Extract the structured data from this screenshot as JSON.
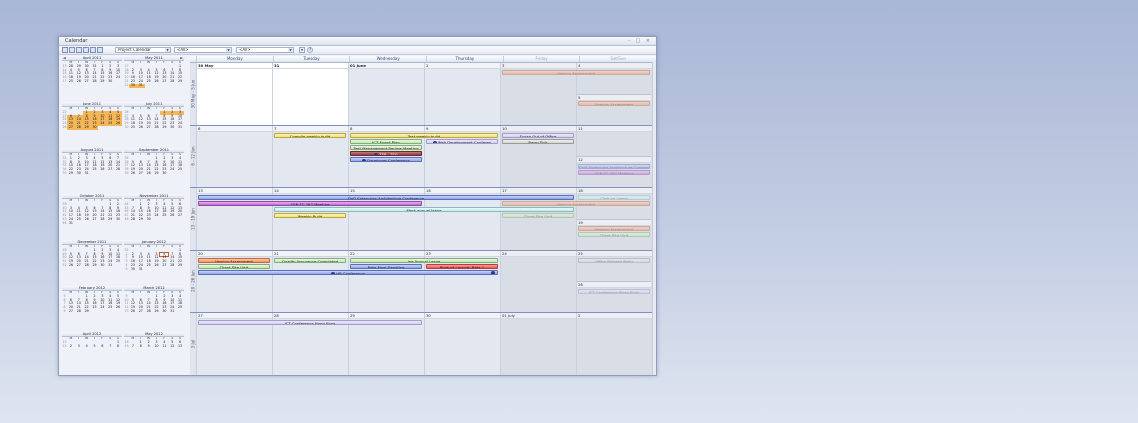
{
  "window": {
    "title": "Calendar",
    "controls": "- □ ×"
  },
  "toolbar": {
    "calendar_select": "Project Calendar",
    "filter1": "<All>",
    "filter2": "<All>"
  },
  "day_headers": [
    "Monday",
    "Tuesday",
    "Wednesday",
    "Thursday",
    "Friday",
    "Sat/Sun"
  ],
  "mini_months": [
    {
      "name": "April 2011",
      "rows": [
        "13 28 29 30 31 1 2 3",
        "14 4 5 6 7 8 9 10",
        "15 11 12 13 14 15 16 17",
        "16 18 19 20 21 22 23 24",
        "17 25 26 27 28 29 30"
      ]
    },
    {
      "name": "May 2011",
      "rows": [
        "17 . . . . . . 1",
        "18 2 3 4 5 6 7 8",
        "19 9 10 11 12 13 14 15",
        "20 16 17 18 19 20 21 22",
        "21 23 24 25 26 27 28 29",
        "22 30 31"
      ]
    },
    {
      "name": "June 2011",
      "rows": [
        "22 . . 1 2 3 4 5",
        "23 6 7 8 9 10 11 12",
        "24 13 14 15 16 17 18 19",
        "25 20 21 22 23 24 25 26",
        "26 27 28 29 30"
      ]
    },
    {
      "name": "July 2011",
      "rows": [
        "26 . . . . 1 2 3",
        "27 4 5 6 7 8 9 10",
        "28 11 12 13 14 15 16 17",
        "29 18 19 20 21 22 23 24",
        "30 25 26 27 28 29 30 31"
      ]
    },
    {
      "name": "August 2011",
      "rows": [
        "31 1 2 3 4 5 6 7",
        "32 8 9 10 11 12 13 14",
        "33 15 16 17 18 19 20 21",
        "34 22 23 24 25 26 27 28",
        "35 29 30 31"
      ]
    },
    {
      "name": "September 2011",
      "rows": [
        "35 . . . 1 2 3 4",
        "36 5 6 7 8 9 10 11",
        "37 12 13 14 15 16 17 18",
        "38 19 20 21 22 23 24 25",
        "39 26 27 28 29 30"
      ]
    },
    {
      "name": "October 2011",
      "rows": [
        "39 . . . . . 1 2",
        "40 3 4 5 6 7 8 9",
        "41 10 11 12 13 14 15 16",
        "42 17 18 19 20 21 22 23",
        "43 24 25 26 27 28 29 30",
        "44 31"
      ]
    },
    {
      "name": "November 2011",
      "rows": [
        "44 . 1 2 3 4 5 6",
        "45 7 8 9 10 11 12 13",
        "46 14 15 16 17 18 19 20",
        "47 21 22 23 24 25 26 27",
        "48 28 29 30"
      ]
    },
    {
      "name": "December 2011",
      "rows": [
        "48 . . . 1 2 3 4",
        "49 5 6 7 8 9 10 11",
        "50 12 13 14 15 16 17 18",
        "51 19 20 21 22 23 24 25",
        "52 26 27 28 29 30 31"
      ]
    },
    {
      "name": "January 2012",
      "rows": [
        "52 . . . . . . 1",
        "1 2 3 4 5 6 7 8",
        "2 9 10 11 12 13 14 15",
        "3 16 17 18 19 20 21 22",
        "4 23 24 25 26 27 28 29",
        "5 30 31"
      ]
    },
    {
      "name": "February 2012",
      "rows": [
        "5 . . 1 2 3 4 5",
        "6 6 7 8 9 10 11 12",
        "7 13 14 15 16 17 18 19",
        "8 20 21 22 23 24 25 26",
        "9 27 28 29"
      ]
    },
    {
      "name": "March 2012",
      "rows": [
        "9 . . . 1 2 3 4",
        "10 5 6 7 8 9 10 11",
        "11 12 13 14 15 16 17 18",
        "12 19 20 21 22 23 24 25",
        "13 26 27 28 29 30 31"
      ]
    },
    {
      "name": "April 2012",
      "rows": [
        "13 . . . . . . 1",
        "14 2 3 4 5 6 7 8"
      ]
    },
    {
      "name": "May 2012",
      "rows": [
        "18 . 1 2 3 4 5 6",
        "19 7 8 9 10 11 12 13"
      ]
    }
  ],
  "weekday_initials": "M T W T F S S",
  "weeks": [
    {
      "label": "30 May - 5 Jun",
      "dates": [
        "30 May",
        "31",
        "01 June",
        "2",
        "3",
        "4"
      ],
      "sun": "5"
    },
    {
      "label": "6 - 12 Jun",
      "dates": [
        "6",
        "7",
        "8",
        "9",
        "10",
        "11"
      ],
      "sun": "12"
    },
    {
      "label": "13 - 19 Jun",
      "dates": [
        "13",
        "14",
        "15",
        "16",
        "17",
        "18"
      ],
      "sun": "19"
    },
    {
      "label": "20 - 26 Jun",
      "dates": [
        "20",
        "21",
        "22",
        "23",
        "24",
        "25"
      ],
      "sun": "26"
    },
    {
      "label": "3 Jul",
      "dates": [
        "27",
        "28",
        "29",
        "30",
        "01 July",
        "2"
      ],
      "sun": ""
    }
  ],
  "events": {
    "w1_fri": "Version Assessment",
    "w1_sun": "Version Assessment",
    "w2_tue": "Compile weekly build",
    "w2_wed_thu": "Test weekly build",
    "w2_wed_1": "ICT Event Plan",
    "w2_wed_2": "Test Management Review Meeting",
    "w2_wed_3": "TSP - TSG",
    "w2_wed_4": "Developer Conference",
    "w2_thu": "Web Development Conferen",
    "w2_fri_1": "Susan Out of Office",
    "w2_fri_2": "Barry Sick",
    "w2_sun_1": "DoD Enterprise Architecture Confere",
    "w2_sun_2": "CEN TC 287 Meeting",
    "w3_span1": "DoD Enterprise Architecture Conference",
    "w3_span2": "CEN TC 287 Meeting",
    "w3_fri": "Version Assessment",
    "w3_annual": "Mark annual leave",
    "w3_tue": "Weekly Build",
    "w3_fri2": "Client Site Visit",
    "w3_sat": "Click on Leave",
    "w3_sun_1": "Version Assessment",
    "w3_sun_2": "Client Site Visit",
    "w4_mon_1": "Version Assessment",
    "w4_tue_1": "Quality Assurance Completed",
    "w4_wedthu": "Joe Annual Leave",
    "w4_mon_2": "Client Site Visit",
    "w4_wed_2": "Beta Final Deadline",
    "w4_thu_2": "Product Launch: Beta 1",
    "w4_span": "HR Conference",
    "w4_sat": "Office Release Party",
    "w4_sun": "ICT Conference Hong Kong",
    "w5_span": "ICT Conference Hong Kong"
  }
}
